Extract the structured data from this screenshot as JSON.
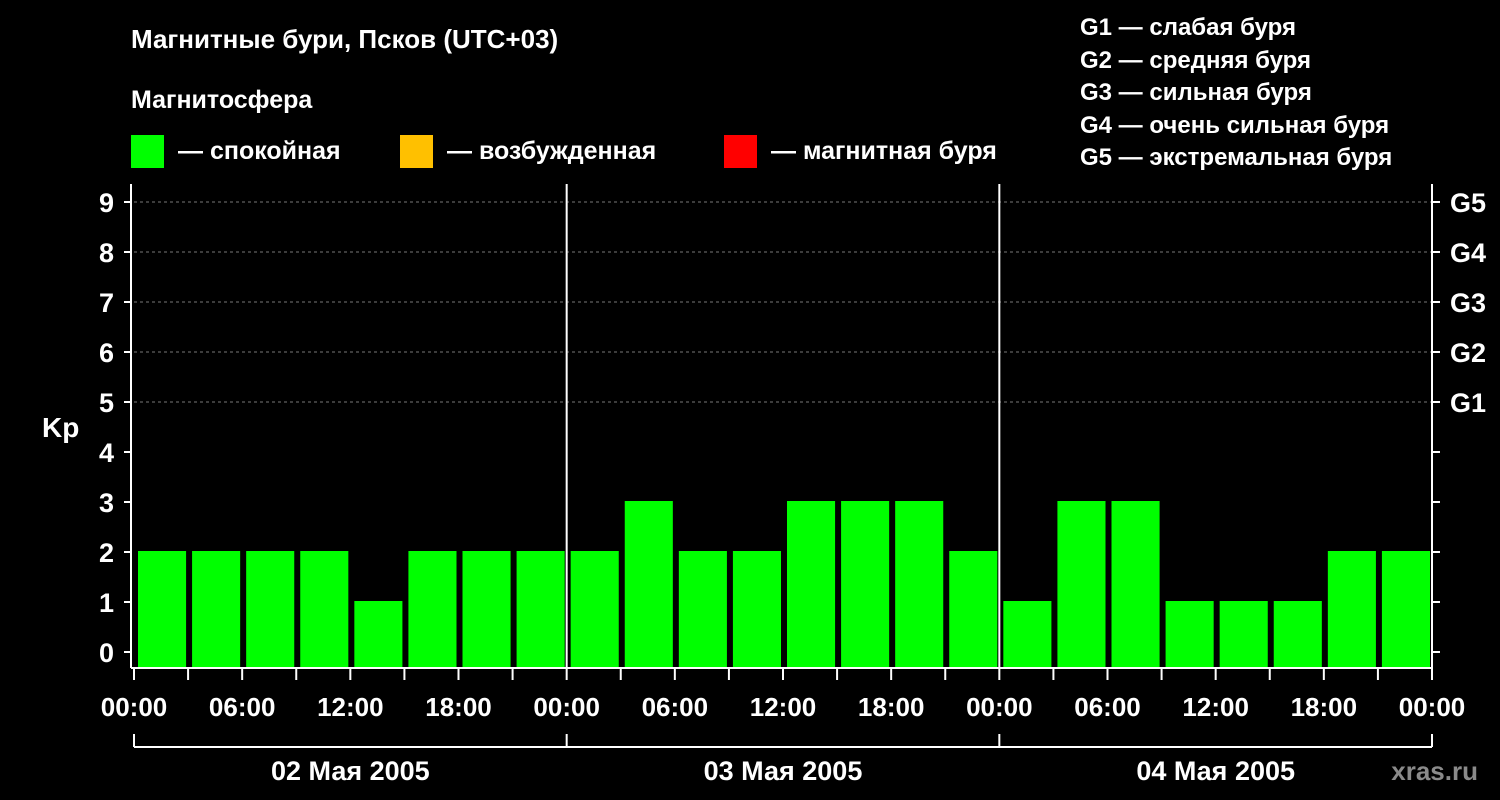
{
  "title": "Магнитные бури, Псков (UTC+03)",
  "subtitle": "Магнитосфера",
  "legend": [
    {
      "label": "— спокойная",
      "color": "#00ff00"
    },
    {
      "label": "— возбужденная",
      "color": "#ffc000"
    },
    {
      "label": "— магнитная буря",
      "color": "#ff0000"
    }
  ],
  "g_legend": [
    "G1 — слабая буря",
    "G2 — средняя буря",
    "G3 — сильная буря",
    "G4 — очень сильная буря",
    "G5 — экстремальная буря"
  ],
  "watermark": "xras.ru",
  "chart_data": {
    "type": "bar",
    "ylabel": "Kp",
    "ylim": [
      0,
      9
    ],
    "yticks": [
      "0",
      "1",
      "2",
      "3",
      "4",
      "5",
      "6",
      "7",
      "8",
      "9"
    ],
    "g_ticks": [
      {
        "kp": 5,
        "label": "G1"
      },
      {
        "kp": 6,
        "label": "G2"
      },
      {
        "kp": 7,
        "label": "G3"
      },
      {
        "kp": 8,
        "label": "G4"
      },
      {
        "kp": 9,
        "label": "G5"
      }
    ],
    "grid": "dashed horizontal at Kp 5–9",
    "x_tick_labels": [
      "00:00",
      "06:00",
      "12:00",
      "18:00",
      "00:00",
      "06:00",
      "12:00",
      "18:00",
      "00:00",
      "06:00",
      "12:00",
      "18:00",
      "00:00"
    ],
    "days": [
      "02 Мая 2005",
      "03 Мая 2005",
      "04 Мая 2005"
    ],
    "interval_hours": 3,
    "values": [
      2,
      2,
      2,
      2,
      1,
      2,
      2,
      2,
      2,
      3,
      2,
      2,
      3,
      3,
      3,
      2,
      1,
      3,
      3,
      1,
      1,
      1,
      2,
      2
    ],
    "bar_color": "#00ff00"
  }
}
